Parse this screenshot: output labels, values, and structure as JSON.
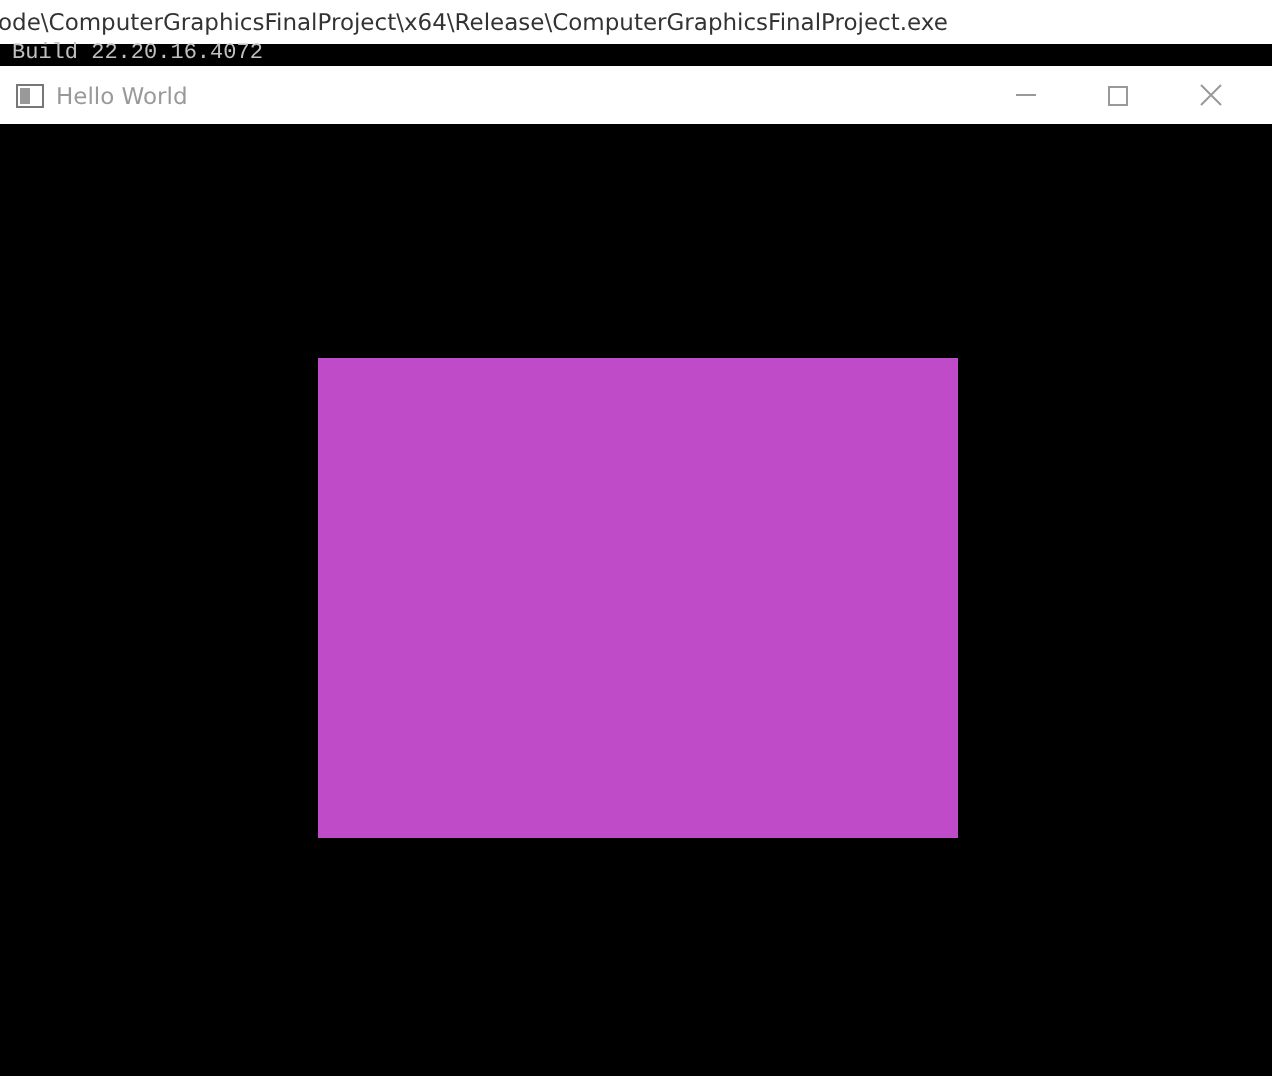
{
  "path_bar": {
    "text": "ode\\ComputerGraphicsFinalProject\\x64\\Release\\ComputerGraphicsFinalProject.exe"
  },
  "console": {
    "text": "Build 22.20.16.4072"
  },
  "window": {
    "title": "Hello World"
  }
}
